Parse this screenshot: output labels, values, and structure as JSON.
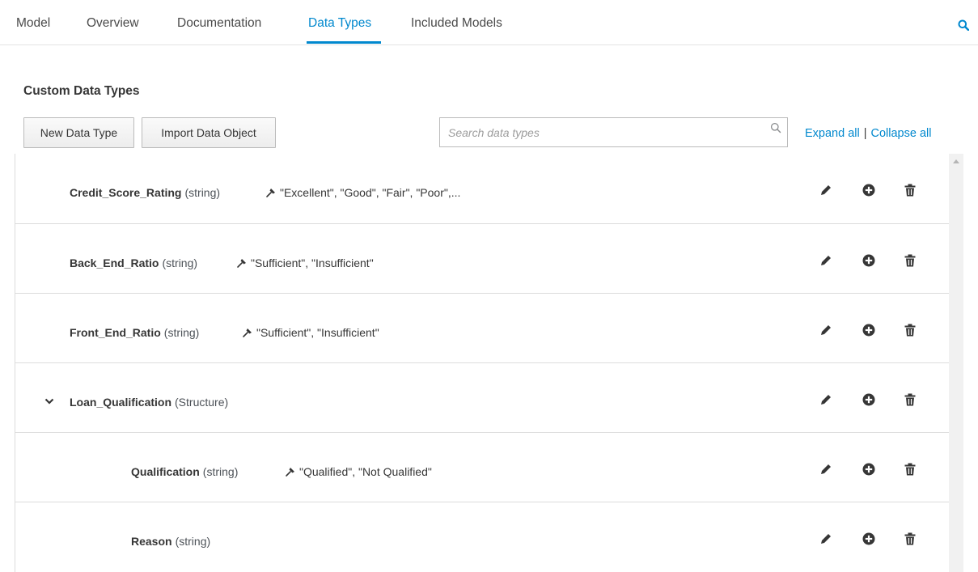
{
  "nav": {
    "tabs": [
      {
        "label": "Model"
      },
      {
        "label": "Overview"
      },
      {
        "label": "Documentation"
      },
      {
        "label": "Data Types",
        "active": true
      },
      {
        "label": "Included Models"
      }
    ],
    "search_icon": "search-icon",
    "accent_color": "#0088ce"
  },
  "section": {
    "title": "Custom Data Types"
  },
  "toolbar": {
    "new_label": "New Data Type",
    "import_label": "Import Data Object",
    "search_placeholder": "Search data types",
    "expand_label": "Expand all",
    "separator": "|",
    "collapse_label": "Collapse all"
  },
  "data_types": [
    {
      "name": "Credit_Score_Rating",
      "type": "(string)",
      "constraint": "\"Excellent\", \"Good\", \"Fair\", \"Poor\",..."
    },
    {
      "name": "Back_End_Ratio",
      "type": "(string)",
      "constraint": "\"Sufficient\", \"Insufficient\""
    },
    {
      "name": "Front_End_Ratio",
      "type": "(string)",
      "constraint": "\"Sufficient\", \"Insufficient\""
    },
    {
      "name": "Loan_Qualification",
      "type": "(Structure)",
      "constraint": "",
      "expanded": true
    },
    {
      "name": "Qualification",
      "type": "(string)",
      "constraint": "\"Qualified\", \"Not Qualified\""
    },
    {
      "name": "Reason",
      "type": "(string)",
      "constraint": ""
    }
  ],
  "row_actions": [
    "pencil-icon",
    "plus-circle-icon",
    "trash-icon"
  ]
}
